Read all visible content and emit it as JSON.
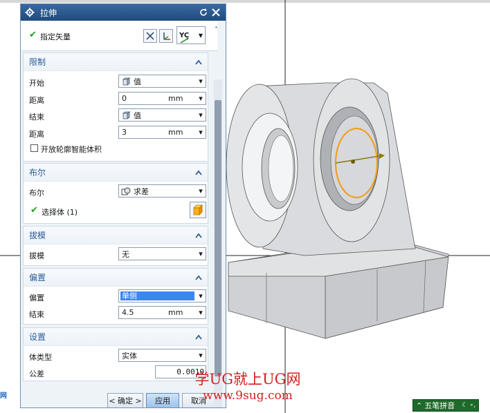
{
  "dialog": {
    "title": "拉伸",
    "vector": {
      "label": "指定矢量",
      "dir_label": "YC"
    },
    "limits": {
      "header": "限制",
      "start_label": "开始",
      "start_mode": "值",
      "start_dist_label": "距离",
      "start_dist_value": "0",
      "start_dist_unit": "mm",
      "end_label": "结束",
      "end_mode": "值",
      "end_dist_label": "距离",
      "end_dist_value": "3",
      "end_dist_unit": "mm",
      "open_profile_label": "开放轮廓智能体积",
      "open_profile_checked": false
    },
    "boolean": {
      "header": "布尔",
      "label": "布尔",
      "value": "求差",
      "select_body_label": "选择体 (1)"
    },
    "draft": {
      "header": "拔模",
      "label": "拔模",
      "value": "无"
    },
    "offset": {
      "header": "偏置",
      "label": "偏置",
      "value": "单侧",
      "end_label": "结束",
      "end_value": "4.5",
      "end_unit": "mm"
    },
    "settings": {
      "header": "设置",
      "body_type_label": "体类型",
      "body_type_value": "实体",
      "tolerance_label": "公差",
      "tolerance_value": "0.0010"
    },
    "buttons": {
      "ok": "< 确定 >",
      "apply": "应用",
      "cancel": "取消"
    }
  },
  "watermark": {
    "line1": "学UG就上UG网",
    "line2": "www.9sug.com"
  },
  "ime": {
    "label": "五笔拼音"
  },
  "left_logo": {
    "text": "网"
  },
  "colors": {
    "title_bar": "#2a5a8e",
    "section_header_text": "#2a5c9a",
    "selected_field": "#3d86f0",
    "watermark": "#d0201f",
    "sketch_circle": "#f0a020",
    "ime_bar": "#1f6a2a"
  }
}
